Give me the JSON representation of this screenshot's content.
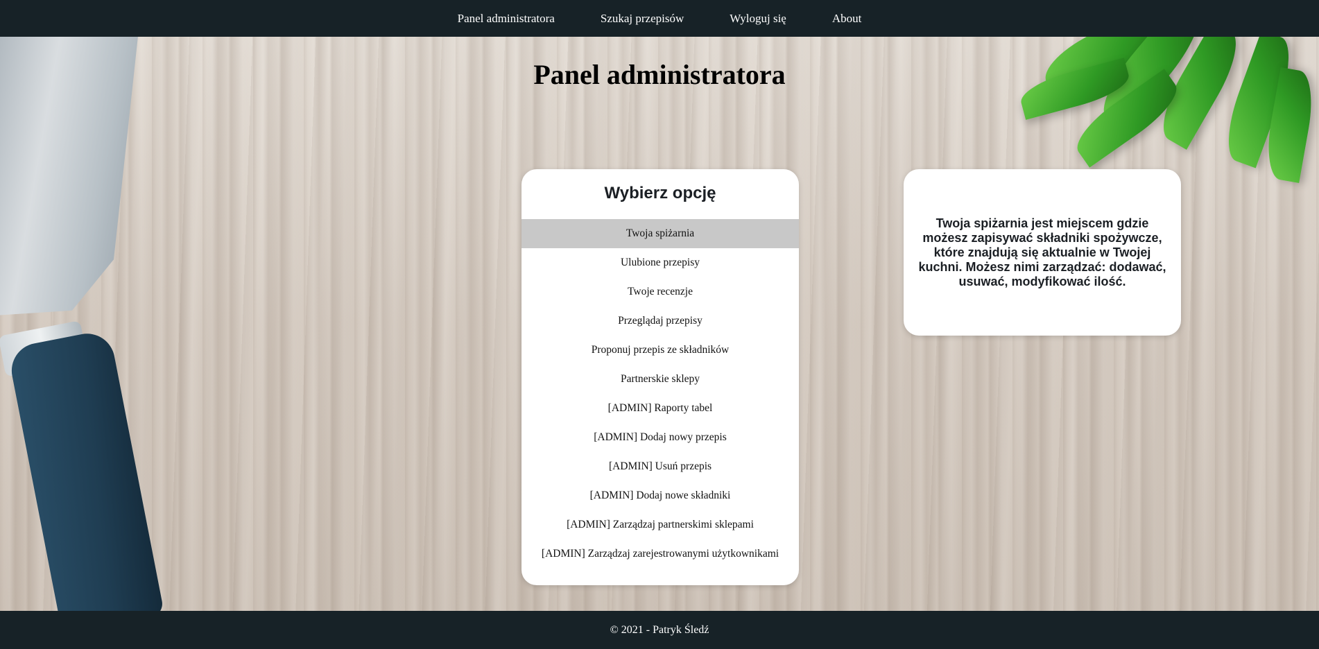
{
  "nav": {
    "items": [
      {
        "label": "Panel administratora"
      },
      {
        "label": "Szukaj przepisów"
      },
      {
        "label": "Wyloguj się"
      },
      {
        "label": "About"
      }
    ]
  },
  "page": {
    "title": "Panel administratora"
  },
  "menu": {
    "heading": "Wybierz opcję",
    "active_index": 0,
    "items": [
      {
        "label": "Twoja spiżarnia"
      },
      {
        "label": "Ulubione przepisy"
      },
      {
        "label": "Twoje recenzje"
      },
      {
        "label": "Przeglądaj przepisy"
      },
      {
        "label": "Proponuj przepis ze składników"
      },
      {
        "label": "Partnerskie sklepy"
      },
      {
        "label": "[ADMIN] Raporty tabel"
      },
      {
        "label": "[ADMIN] Dodaj nowy przepis"
      },
      {
        "label": "[ADMIN] Usuń przepis"
      },
      {
        "label": "[ADMIN] Dodaj nowe składniki"
      },
      {
        "label": "[ADMIN] Zarządzaj partnerskimi sklepami"
      },
      {
        "label": "[ADMIN] Zarządzaj zarejestrowanymi użytkownikami"
      }
    ]
  },
  "info": {
    "text": "Twoja spiżarnia jest miejscem gdzie możesz zapisywać składniki spożywcze, które znajdują się aktualnie w Twojej kuchni. Możesz nimi zarządzać: dodawać, usuwać, modyfikować ilość."
  },
  "footer": {
    "text": "© 2021 - Patryk Śledź"
  },
  "colors": {
    "nav_bg": "#172227",
    "active_item_bg": "#c8c8c8",
    "card_bg": "#ffffff"
  }
}
